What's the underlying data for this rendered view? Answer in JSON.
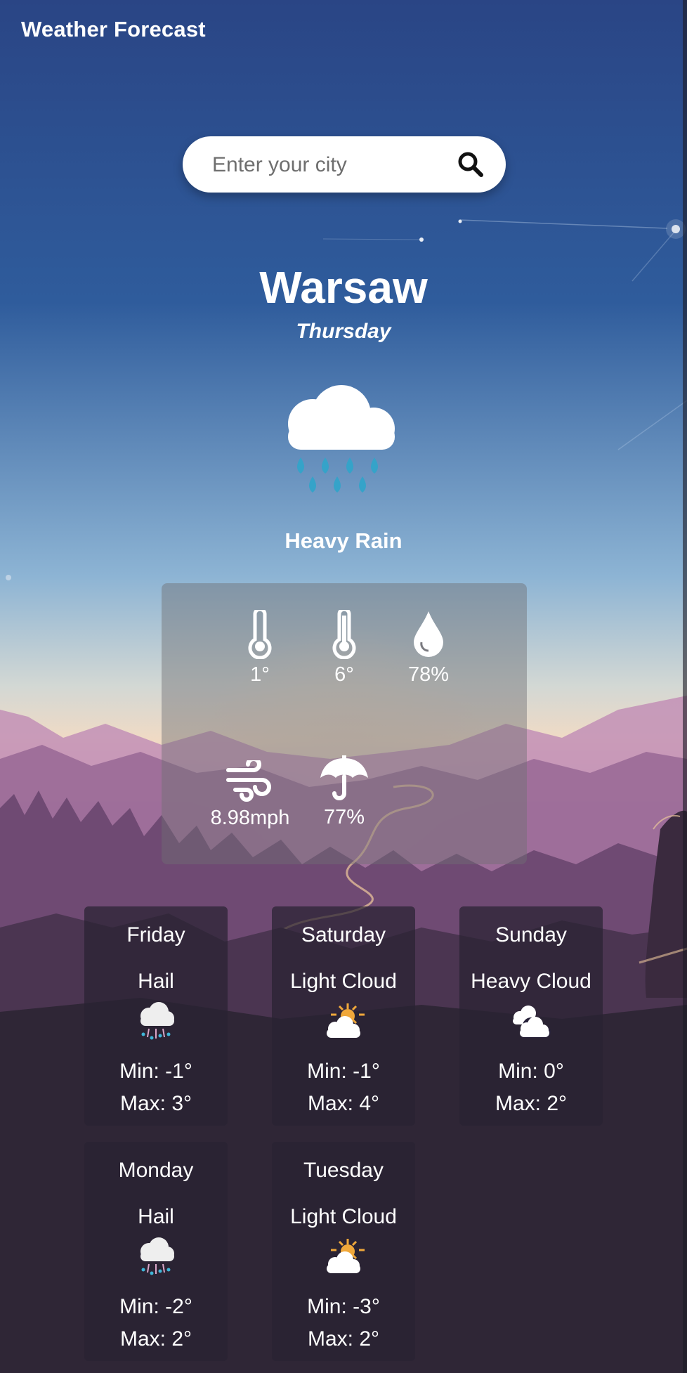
{
  "app": {
    "title": "Weather Forecast"
  },
  "search": {
    "placeholder": "Enter your city",
    "value": ""
  },
  "current": {
    "city": "Warsaw",
    "day": "Thursday",
    "condition": "Heavy Rain",
    "icon": "heavy-rain-icon",
    "min_temp": "1°",
    "max_temp": "6°",
    "humidity": "78%",
    "wind": "8.98mph",
    "precipitation": "77%"
  },
  "forecast": [
    {
      "day": "Friday",
      "condition": "Hail",
      "icon": "hail-icon",
      "min": "Min: -1°",
      "max": "Max: 3°"
    },
    {
      "day": "Saturday",
      "condition": "Light Cloud",
      "icon": "light-cloud-icon",
      "min": "Min: -1°",
      "max": "Max: 4°"
    },
    {
      "day": "Sunday",
      "condition": "Heavy Cloud",
      "icon": "heavy-cloud-icon",
      "min": "Min: 0°",
      "max": "Max: 2°"
    },
    {
      "day": "Monday",
      "condition": "Hail",
      "icon": "hail-icon",
      "min": "Min: -2°",
      "max": "Max: 2°"
    },
    {
      "day": "Tuesday",
      "condition": "Light Cloud",
      "icon": "light-cloud-icon",
      "min": "Min: -3°",
      "max": "Max: 2°"
    }
  ],
  "colors": {
    "sky_top": "#2a4585",
    "sky_mid": "#4f86bd",
    "horizon": "#f1dac4",
    "rain_drop": "#35a3c9",
    "sun": "#f0a83b",
    "card_bg": "#28223a"
  }
}
